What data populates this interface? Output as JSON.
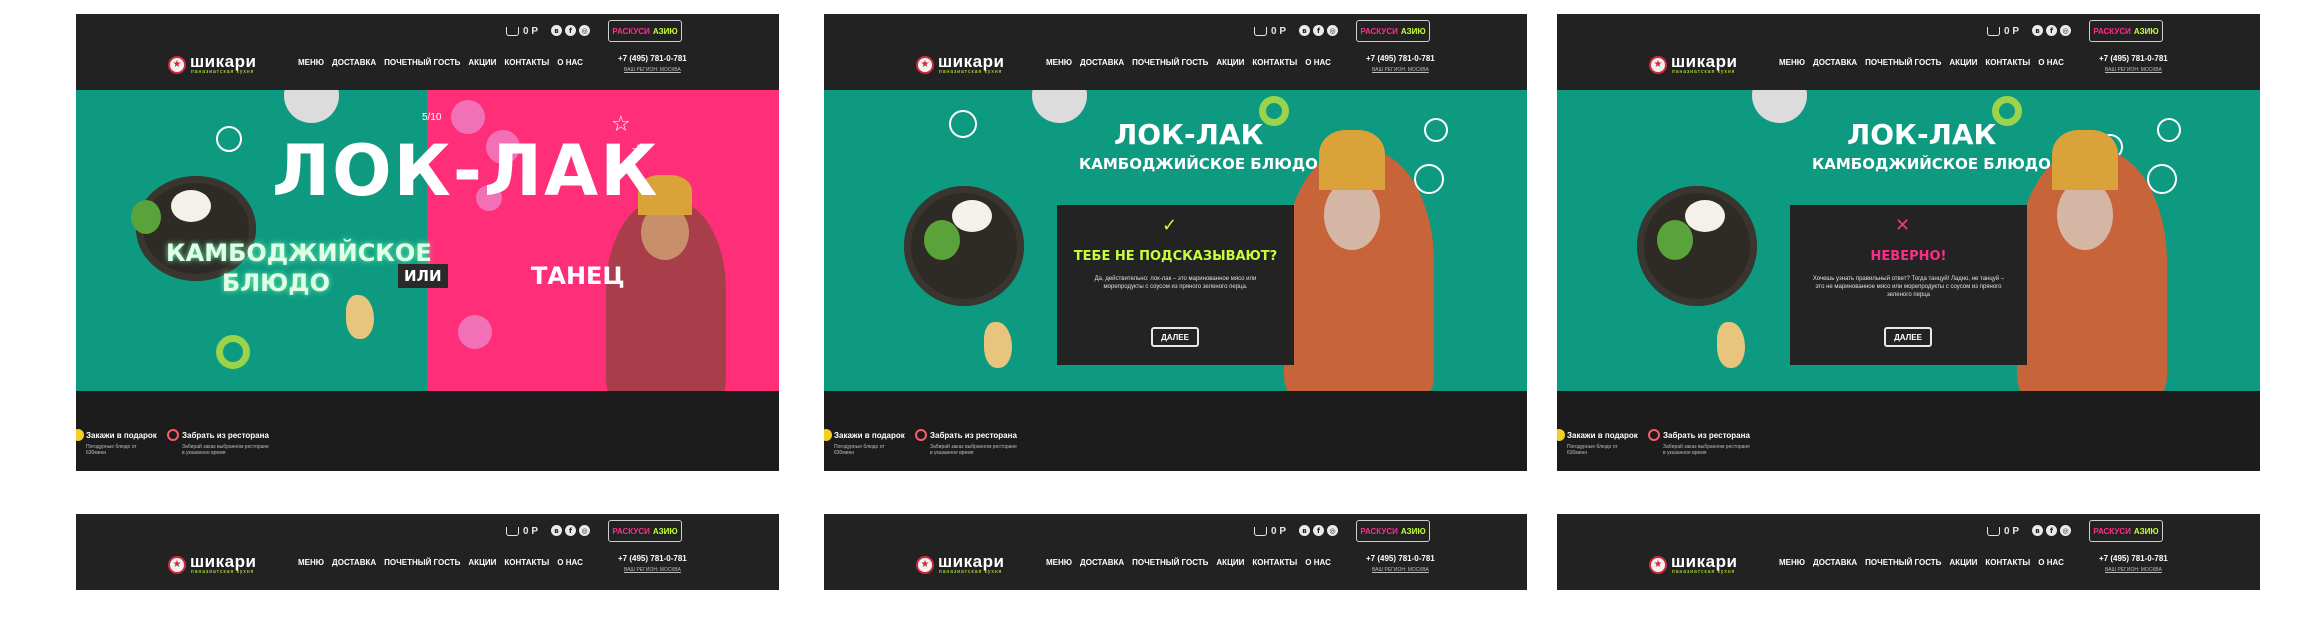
{
  "header": {
    "cart_amount": "0 Р",
    "socials": [
      "vk-icon",
      "facebook-icon",
      "instagram-icon"
    ],
    "promo": {
      "part1": "РАСКУСИ",
      "part2": "АЗИЮ"
    },
    "logo": {
      "name": "шикари",
      "tagline": "паназиатская кухня"
    },
    "nav": [
      "МЕНЮ",
      "ДОСТАВКА",
      "ПОЧЕТНЫЙ ГОСТЬ",
      "АКЦИИ",
      "КОНТАКТЫ",
      "О НАС"
    ],
    "phone": "+7 (495) 781-0-781",
    "region": "ВАШ РЕГИОН: МОСКВА"
  },
  "slide1": {
    "counter": "5/10",
    "title": "ЛОК-ЛАК",
    "option_a": "КАМБОДЖИЙСКОЕ БЛЮДО",
    "or": "ИЛИ",
    "option_b": "ТАНЕЦ"
  },
  "slide_common": {
    "title": "ЛОК-ЛАК",
    "subtitle": "КАМБОДЖИЙСКОЕ БЛЮДО"
  },
  "slide2": {
    "icon": "check-icon",
    "question": "ТЕБЕ НЕ ПОДСКАЗЫВАЮТ?",
    "text": "Да, действительно: лок-лак – это маринованное мясо или морепродукты с соусом из пряного зеленого перца.",
    "button": "ДАЛЕЕ"
  },
  "slide3": {
    "icon": "cross-icon",
    "question": "НЕВЕРНО!",
    "text": "Хочешь узнать правильный ответ? Тогда танцуй! Ладно, не танцуй – это не маринованное мясо или морепродукты с соусом из пряного зеленого перца",
    "button": "ДАЛЕЕ"
  },
  "footer": {
    "gift_title": "Закажи в подарок",
    "gift_sub": "Погодурные блюдо от 630минн",
    "pickup_title": "Забрать из ресторана",
    "pickup_sub": "Забирай заказ выбранном ресторане в указанное время"
  },
  "colors": {
    "teal": "#0e9a80",
    "pink": "#ff2e78",
    "lime": "#c6ff3a",
    "magenta": "#ff2d8a",
    "dark": "#222222"
  }
}
